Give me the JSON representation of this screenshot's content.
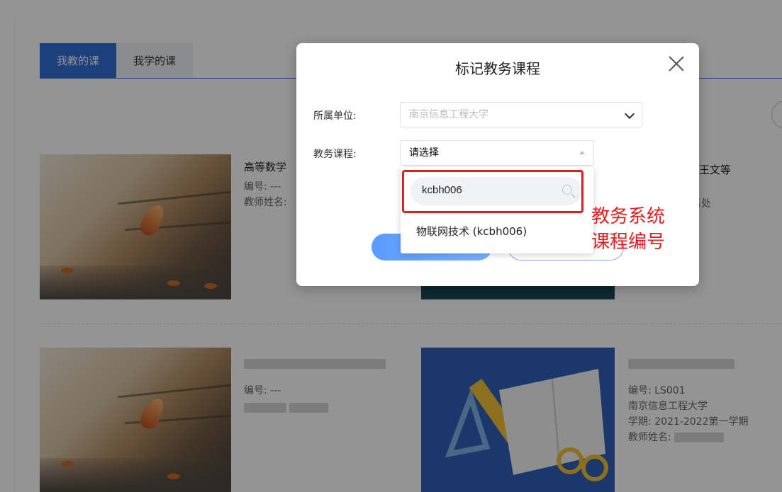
{
  "tabs": [
    {
      "label": "我教的课",
      "active": true
    },
    {
      "label": "我学的课",
      "active": false
    }
  ],
  "courses": {
    "row1_left": {
      "title": "高等数学",
      "code_label": "编号: ---",
      "teacher_label": "教师姓名:"
    },
    "row1_right": {
      "title_suffix": "--王文等",
      "dept_suffix": "务处"
    },
    "row2_left": {
      "code_label": "编号: ---"
    },
    "row2_right": {
      "code_label": "编号: LS001",
      "school": "南京信息工程大学",
      "term": "学期: 2021-2022第一学期",
      "teacher_label": "教师姓名:"
    }
  },
  "modal": {
    "title": "标记教务课程",
    "unit_label": "所属单位:",
    "unit_value": "南京信息工程大学",
    "course_label": "教务课程:",
    "course_placeholder": "请选择",
    "search_value": "kcbh006",
    "option_label": "物联网技术 (kcbh006)"
  },
  "annotation": {
    "line1": "教务系统",
    "line2": "课程编号"
  },
  "colors": {
    "accent": "#2f6fd6",
    "annotation_red": "#e02020"
  }
}
